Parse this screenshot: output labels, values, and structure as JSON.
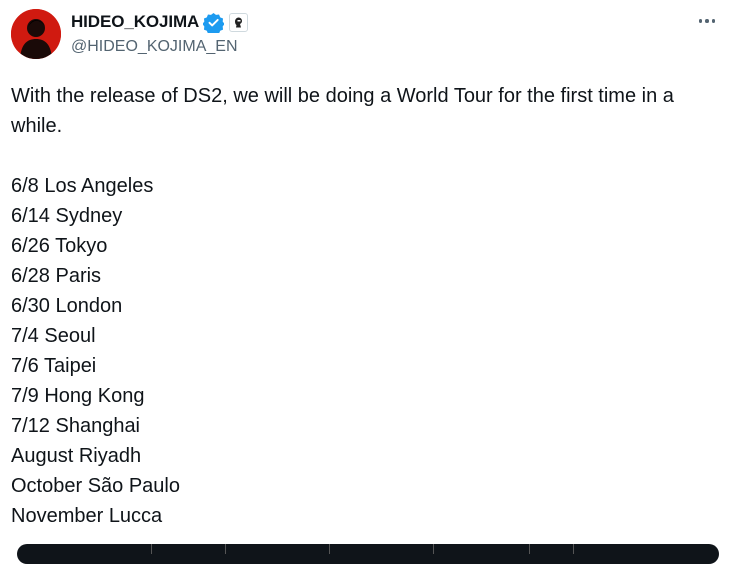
{
  "author": {
    "display_name": "HIDEO_KOJIMA",
    "handle": "@HIDEO_KOJIMA_EN",
    "verified_color": "#1d9bf0",
    "avatar_color": "#d01a10"
  },
  "tweet": {
    "intro": "With the release of DS2, we will be doing a World Tour for the first time in a while.",
    "tour_dates": [
      "6/8 Los Angeles",
      "6/14 Sydney",
      "6/26 Tokyo",
      "6/28 Paris",
      "6/30 London",
      "7/4 Seoul",
      "7/6 Taipei",
      "7/9 Hong Kong",
      "7/12 Shanghai",
      "August Riyadh",
      "October São Paulo",
      "November Lucca"
    ]
  },
  "icons": {
    "verified": "verified-check-icon",
    "affiliate": "affiliate-badge-icon",
    "more": "more-options-icon"
  }
}
